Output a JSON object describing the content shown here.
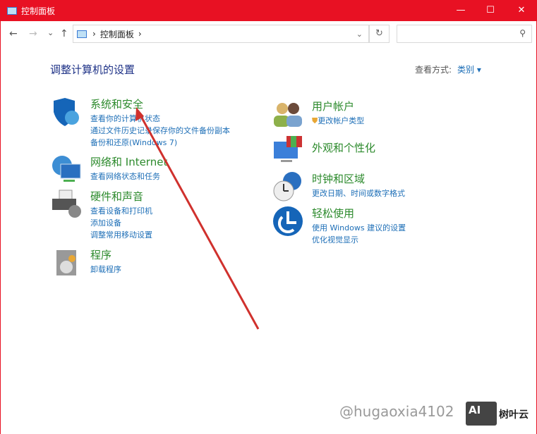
{
  "window": {
    "title": "控制面板",
    "minimize": "—",
    "maximize": "☐",
    "close": "✕"
  },
  "nav": {
    "back": "←",
    "forward": "→",
    "recent": "⌄",
    "up": "↑",
    "breadcrumb": [
      "控制面板"
    ],
    "sep": "›",
    "refresh": "↻",
    "search_placeholder": "",
    "search_icon": "⚲"
  },
  "heading": "调整计算机的设置",
  "view_by": {
    "label": "查看方式:",
    "value": "类别 ▾"
  },
  "categories": [
    {
      "title": "系统和安全",
      "links": [
        "查看你的计算机状态",
        "通过文件历史记录保存你的文件备份副本",
        "备份和还原(Windows 7)"
      ]
    },
    {
      "title": "网络和 Internet",
      "links": [
        "查看网络状态和任务"
      ]
    },
    {
      "title": "硬件和声音",
      "links": [
        "查看设备和打印机",
        "添加设备",
        "调整常用移动设置"
      ]
    },
    {
      "title": "程序",
      "links": [
        "卸载程序"
      ]
    },
    {
      "title": "用户帐户",
      "links": [
        "更改帐户类型"
      ]
    },
    {
      "title": "外观和个性化",
      "links": []
    },
    {
      "title": "时钟和区域",
      "links": [
        "更改日期、时间或数字格式"
      ]
    },
    {
      "title": "轻松使用",
      "links": [
        "使用 Windows 建议的设置",
        "优化视觉显示"
      ]
    }
  ],
  "watermark": {
    "text": "@hugaoxia4102",
    "logo": "AI",
    "brand": "树叶云"
  },
  "colors": {
    "titlebar": "#e81123",
    "link": "#1e6fb7",
    "category": "#2c8a2c",
    "arrow": "#d0312d"
  }
}
